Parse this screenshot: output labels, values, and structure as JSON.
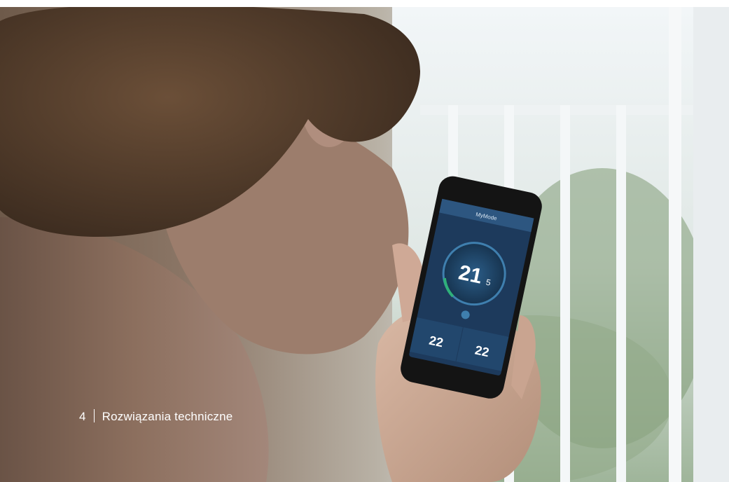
{
  "caption": {
    "page_number": "4",
    "title": "Rozwiązania techniczne"
  },
  "phone_app": {
    "header_title": "MyMode",
    "main_temperature": "21",
    "main_temperature_decimal": "5",
    "zone_left_temperature": "22",
    "zone_right_temperature": "22"
  },
  "colors": {
    "app_background": "#1d3a5c",
    "dial_ring": "#3f7fae",
    "accent_green": "#2fb07a"
  }
}
